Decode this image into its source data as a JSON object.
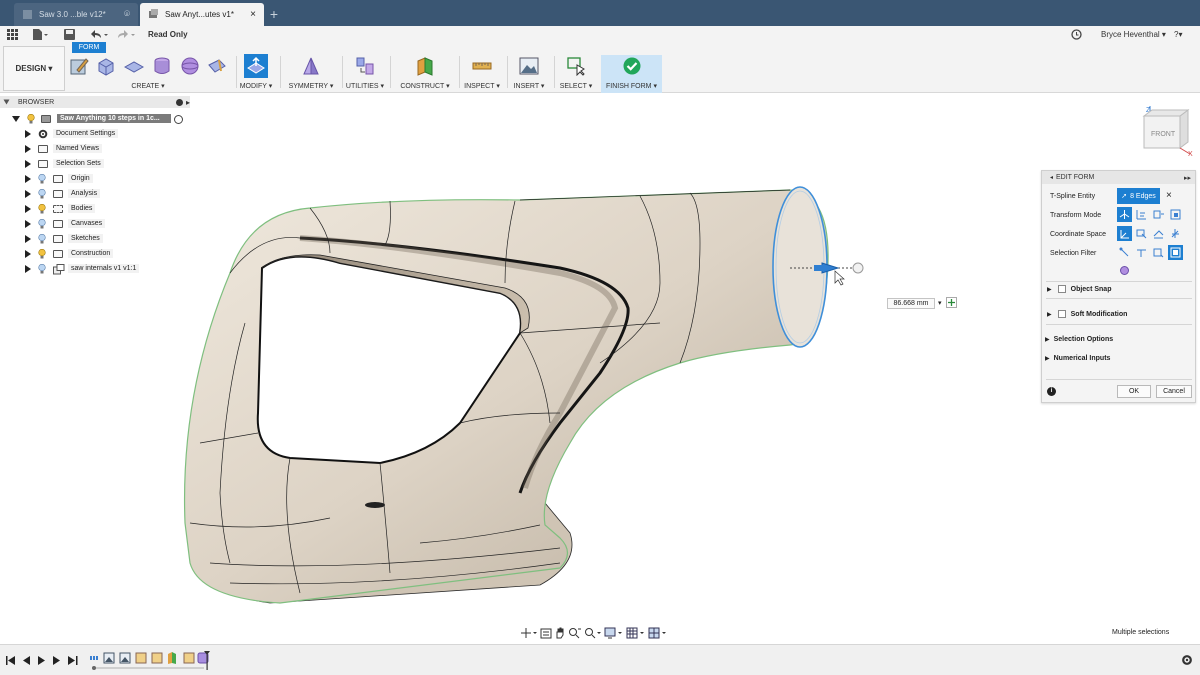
{
  "tabs": [
    {
      "label": "Saw 3.0 ...ble v12*"
    },
    {
      "label": "Saw Anyt...utes v1*"
    }
  ],
  "quick_access": {
    "read_only": "Read Only",
    "user_name": "Bryce Heventhal ▾",
    "help_label": "?▾"
  },
  "toolbar": {
    "workspace": "DESIGN ▾",
    "active_tab": "FORM",
    "groups": {
      "create": "CREATE ▾",
      "modify": "MODIFY ▾",
      "symmetry": "SYMMETRY ▾",
      "utilities": "UTILITIES ▾",
      "construct": "CONSTRUCT ▾",
      "inspect": "INSPECT ▾",
      "insert": "INSERT ▾",
      "select": "SELECT ▾",
      "finish": "FINISH FORM ▾"
    }
  },
  "browser": {
    "title": "BROWSER",
    "root": "Saw Anything 10 steps in 1c...",
    "items": [
      {
        "label": "Document Settings",
        "icon": "gear-icon"
      },
      {
        "label": "Named Views",
        "icon": "folder-icon"
      },
      {
        "label": "Selection Sets",
        "icon": "folder-icon"
      },
      {
        "label": "Origin",
        "icon": "folder-icon"
      },
      {
        "label": "Analysis",
        "icon": "folder-icon"
      },
      {
        "label": "Bodies",
        "icon": "folder-icon"
      },
      {
        "label": "Canvases",
        "icon": "folder-icon"
      },
      {
        "label": "Sketches",
        "icon": "folder-icon"
      },
      {
        "label": "Construction",
        "icon": "folder-icon"
      },
      {
        "label": "saw internals v1 v1:1",
        "icon": "component-icon"
      }
    ]
  },
  "viewcube": {
    "face": "FRONT",
    "axis_z": "Z",
    "axis_x": "X"
  },
  "measure": {
    "value": "86.668 mm"
  },
  "edit_form": {
    "title": "EDIT FORM",
    "tspline_entity_label": "T-Spline Entity",
    "tspline_entity_value": "8 Edges",
    "transform_mode_label": "Transform Mode",
    "coordinate_space_label": "Coordinate Space",
    "selection_filter_label": "Selection Filter",
    "object_snap": "Object Snap",
    "soft_modification": "Soft Modification",
    "selection_options": "Selection Options",
    "numerical_inputs": "Numerical Inputs",
    "ok": "OK",
    "cancel": "Cancel"
  },
  "status": {
    "text": "Multiple selections"
  },
  "colors": {
    "tabbar": "#3a5673",
    "accent": "#1d7fd1",
    "finish_green": "#21a65a",
    "body_surface": "#ddd3c5",
    "selection_blue": "#3f8fd9"
  }
}
